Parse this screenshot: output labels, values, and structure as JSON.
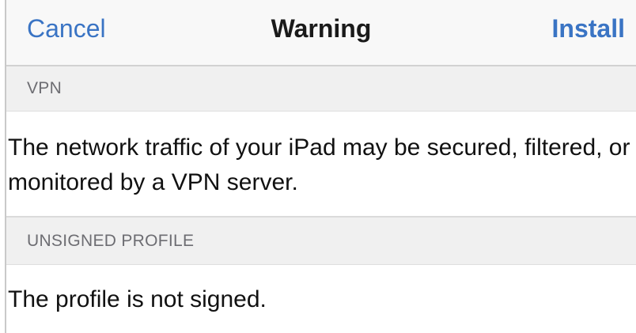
{
  "navbar": {
    "cancel_label": "Cancel",
    "title": "Warning",
    "install_label": "Install"
  },
  "sections": [
    {
      "header": "VPN",
      "body": "The network traffic of your iPad may be secured, filtered, or monitored by a VPN server."
    },
    {
      "header": "UNSIGNED PROFILE",
      "body": "The profile is not signed."
    }
  ],
  "colors": {
    "accent": "#3a74c4",
    "navbar_bg": "#f8f8f8",
    "section_header_bg": "#f0f0f0",
    "section_header_text": "#6d6d72"
  }
}
